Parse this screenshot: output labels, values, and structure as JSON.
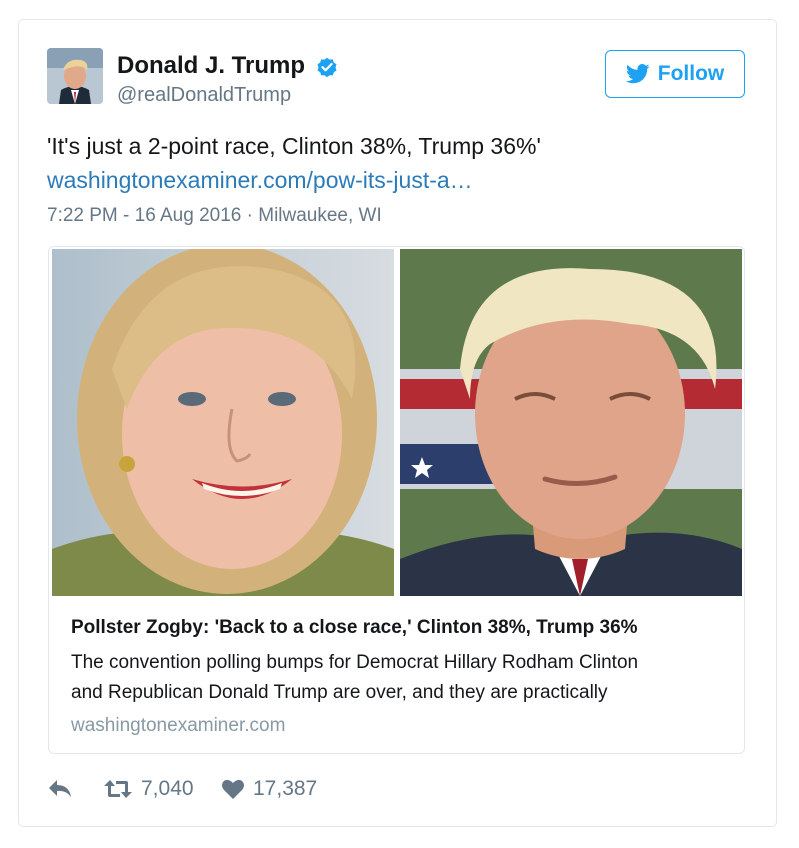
{
  "user": {
    "display_name": "Donald J. Trump",
    "screen_name": "@realDonaldTrump",
    "verified": true
  },
  "follow_button": {
    "label": "Follow"
  },
  "tweet": {
    "text": "'It's just a 2-point race, Clinton 38%, Trump 36%'",
    "link": "washingtonexaminer.com/pow-its-just-a…",
    "meta": "7:22 PM - 16 Aug 2016 · Milwaukee, WI"
  },
  "link_card": {
    "title": "Pollster Zogby: 'Back to a close race,' Clinton 38%, Trump 36%",
    "description_lines": [
      "The convention polling bumps for Democrat Hillary Rodham Clinton",
      "and Republican Donald Trump are over, and they are practically"
    ],
    "domain": "washingtonexaminer.com"
  },
  "actions": {
    "reply_icon": "reply-icon",
    "retweets": "7,040",
    "likes": "17,387"
  },
  "colors": {
    "accent": "#1da1f2",
    "link": "#2b7bb9",
    "muted": "#657786",
    "border": "#e1e8ed"
  }
}
